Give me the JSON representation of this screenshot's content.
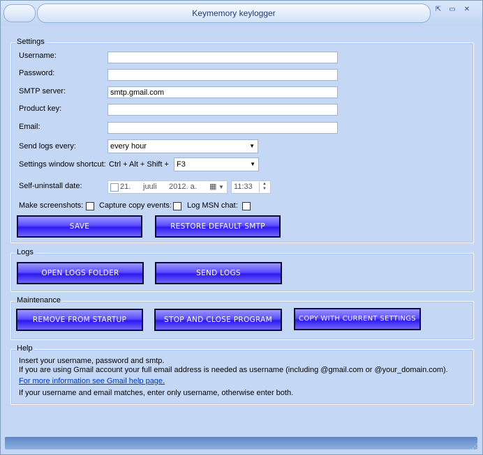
{
  "window": {
    "title": "Keymemory keylogger",
    "restore_glyph": "⇱",
    "maximize_glyph": "▭",
    "close_glyph": "✕"
  },
  "settings": {
    "title": "Settings",
    "username_label": "Username:",
    "username_value": "",
    "password_label": "Password:",
    "password_value": "",
    "smtp_label": "SMTP server:",
    "smtp_value": "smtp.gmail.com",
    "product_key_label": "Product key:",
    "product_key_value": "",
    "email_label": "Email:",
    "email_value": "",
    "send_logs_label": "Send logs every:",
    "send_logs_value": "every hour",
    "shortcut_label": "Settings window shortcut:",
    "shortcut_prefix": "Ctrl + Alt + Shift +",
    "shortcut_value": "F3",
    "uninstall_label": "Self-uninstall date:",
    "uninstall_day": "21.",
    "uninstall_month": "juuli",
    "uninstall_year": "2012. a.",
    "uninstall_time": "11:33",
    "screenshots_label": "Make screenshots:",
    "copy_events_label": "Capture copy events:",
    "msn_label": "Log MSN chat:",
    "save_button": "SAVE",
    "restore_button": "RESTORE DEFAULT SMTP"
  },
  "logs": {
    "title": "Logs",
    "open_folder_button": "OPEN LOGS FOLDER",
    "send_logs_button": "SEND LOGS"
  },
  "maintenance": {
    "title": "Maintenance",
    "remove_startup_button": "REMOVE FROM STARTUP",
    "stop_button": "STOP AND CLOSE PROGRAM",
    "copy_settings_button": "COPY WITH CURRENT SETTINGS"
  },
  "help": {
    "title": "Help",
    "line1": "Insert your username, password and smtp.",
    "line2": "If you are using Gmail account your full email address is needed as username (including @gmail.com or @your_domain.com).",
    "link": "For more information see Gmail help page.",
    "line3": "If your username and email matches, enter only username, otherwise enter both."
  },
  "colors": {
    "button_gradient_top": "#9a97ff",
    "button_gradient_bottom": "#2e18f0",
    "window_background": "#c4d8f5",
    "link": "#0033cc"
  }
}
